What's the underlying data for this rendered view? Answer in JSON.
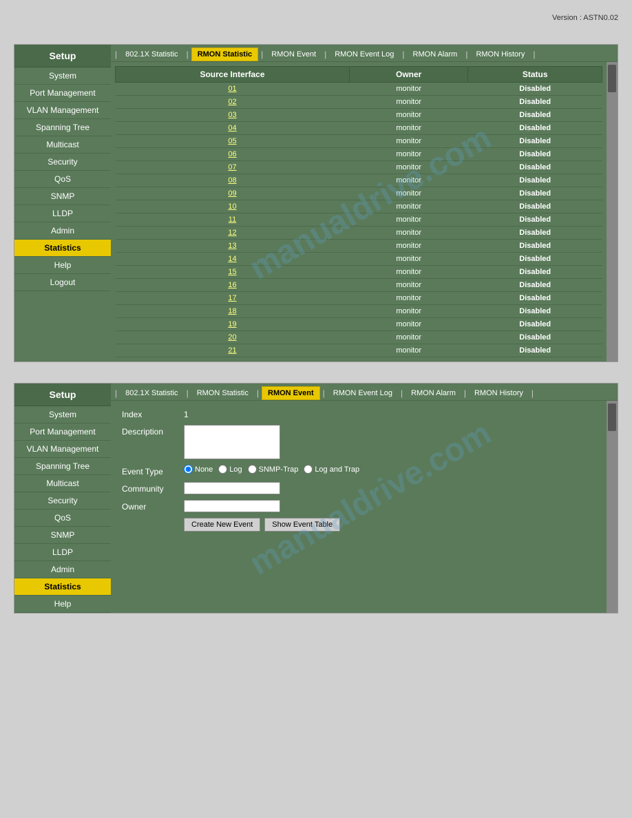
{
  "version": "Version : ASTN0.02",
  "panel1": {
    "sidebar": {
      "title": "Setup",
      "items": [
        {
          "label": "System",
          "active": false
        },
        {
          "label": "Port Management",
          "active": false
        },
        {
          "label": "VLAN Management",
          "active": false
        },
        {
          "label": "Spanning Tree",
          "active": false
        },
        {
          "label": "Multicast",
          "active": false
        },
        {
          "label": "Security",
          "active": false
        },
        {
          "label": "QoS",
          "active": false
        },
        {
          "label": "SNMP",
          "active": false
        },
        {
          "label": "LLDP",
          "active": false
        },
        {
          "label": "Admin",
          "active": false
        },
        {
          "label": "Statistics",
          "active": true
        },
        {
          "label": "Help",
          "active": false
        },
        {
          "label": "Logout",
          "active": false
        }
      ]
    },
    "tabs": [
      {
        "label": "802.1X Statistic",
        "active": false
      },
      {
        "label": "RMON Statistic",
        "active": true
      },
      {
        "label": "RMON Event",
        "active": false
      },
      {
        "label": "RMON Event Log",
        "active": false
      },
      {
        "label": "RMON Alarm",
        "active": false
      },
      {
        "label": "RMON History",
        "active": false
      }
    ],
    "table": {
      "headers": [
        "Source Interface",
        "Owner",
        "Status"
      ],
      "rows": [
        {
          "port": "01",
          "owner": "monitor",
          "status": "Disabled"
        },
        {
          "port": "02",
          "owner": "monitor",
          "status": "Disabled"
        },
        {
          "port": "03",
          "owner": "monitor",
          "status": "Disabled"
        },
        {
          "port": "04",
          "owner": "monitor",
          "status": "Disabled"
        },
        {
          "port": "05",
          "owner": "monitor",
          "status": "Disabled"
        },
        {
          "port": "06",
          "owner": "monitor",
          "status": "Disabled"
        },
        {
          "port": "07",
          "owner": "monitor",
          "status": "Disabled"
        },
        {
          "port": "08",
          "owner": "monitor",
          "status": "Disabled"
        },
        {
          "port": "09",
          "owner": "monitor",
          "status": "Disabled"
        },
        {
          "port": "10",
          "owner": "monitor",
          "status": "Disabled"
        },
        {
          "port": "11",
          "owner": "monitor",
          "status": "Disabled"
        },
        {
          "port": "12",
          "owner": "monitor",
          "status": "Disabled"
        },
        {
          "port": "13",
          "owner": "monitor",
          "status": "Disabled"
        },
        {
          "port": "14",
          "owner": "monitor",
          "status": "Disabled"
        },
        {
          "port": "15",
          "owner": "monitor",
          "status": "Disabled"
        },
        {
          "port": "16",
          "owner": "monitor",
          "status": "Disabled"
        },
        {
          "port": "17",
          "owner": "monitor",
          "status": "Disabled"
        },
        {
          "port": "18",
          "owner": "monitor",
          "status": "Disabled"
        },
        {
          "port": "19",
          "owner": "monitor",
          "status": "Disabled"
        },
        {
          "port": "20",
          "owner": "monitor",
          "status": "Disabled"
        },
        {
          "port": "21",
          "owner": "monitor",
          "status": "Disabled"
        }
      ]
    }
  },
  "panel2": {
    "sidebar": {
      "title": "Setup",
      "items": [
        {
          "label": "System",
          "active": false
        },
        {
          "label": "Port Management",
          "active": false
        },
        {
          "label": "VLAN Management",
          "active": false
        },
        {
          "label": "Spanning Tree",
          "active": false
        },
        {
          "label": "Multicast",
          "active": false
        },
        {
          "label": "Security",
          "active": false
        },
        {
          "label": "QoS",
          "active": false
        },
        {
          "label": "SNMP",
          "active": false
        },
        {
          "label": "LLDP",
          "active": false
        },
        {
          "label": "Admin",
          "active": false
        },
        {
          "label": "Statistics",
          "active": true
        },
        {
          "label": "Help",
          "active": false
        }
      ]
    },
    "tabs": [
      {
        "label": "802.1X Statistic",
        "active": false
      },
      {
        "label": "RMON Statistic",
        "active": false
      },
      {
        "label": "RMON Event",
        "active": true
      },
      {
        "label": "RMON Event Log",
        "active": false
      },
      {
        "label": "RMON Alarm",
        "active": false
      },
      {
        "label": "RMON History",
        "active": false
      }
    ],
    "form": {
      "index_label": "Index",
      "index_value": "1",
      "description_label": "Description",
      "event_type_label": "Event Type",
      "event_type_options": [
        "None",
        "Log",
        "SNMP-Trap",
        "Log and Trap"
      ],
      "event_type_selected": "None",
      "community_label": "Community",
      "owner_label": "Owner",
      "btn_create": "Create New Event",
      "btn_show": "Show Event Table"
    }
  }
}
